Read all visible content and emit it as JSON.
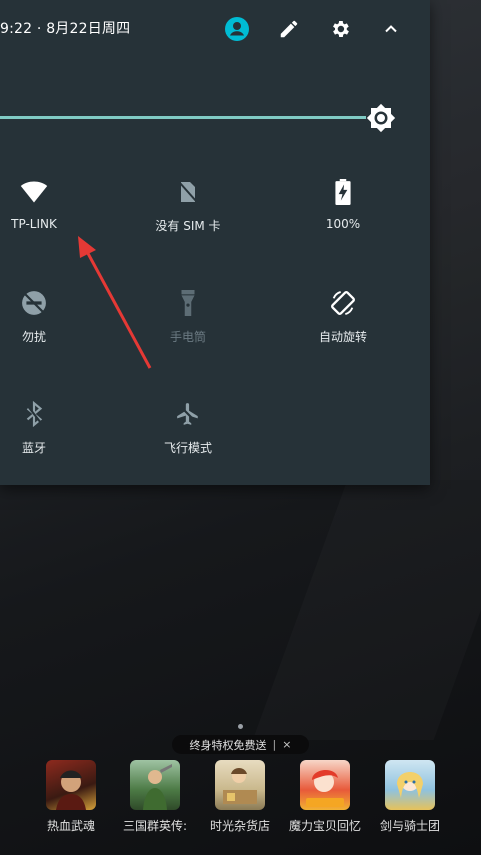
{
  "status_bar": {
    "time_date": "9:22 · 8月22日周四"
  },
  "quick_settings": {
    "tiles": [
      {
        "label": "TP-LINK",
        "icon": "wifi-icon"
      },
      {
        "label": "没有 SIM 卡",
        "icon": "no-sim-icon"
      },
      {
        "label": "100%",
        "icon": "battery-charging-icon"
      },
      {
        "label": "勿扰",
        "icon": "do-not-disturb-icon"
      },
      {
        "label": "手电筒",
        "icon": "flashlight-icon"
      },
      {
        "label": "自动旋转",
        "icon": "auto-rotate-icon"
      },
      {
        "label": "蓝牙",
        "icon": "bluetooth-icon"
      },
      {
        "label": "飞行模式",
        "icon": "airplane-icon"
      }
    ]
  },
  "colors": {
    "shade_bg": "#263238",
    "accent": "#80cbc4",
    "avatar": "#00bcd4",
    "annotation": "#e53935"
  },
  "launcher": {
    "promo": {
      "text": "终身特权免费送",
      "separator": "|",
      "close": "×"
    },
    "apps": [
      {
        "label": "热血武魂"
      },
      {
        "label": "三国群英传:"
      },
      {
        "label": "时光杂货店"
      },
      {
        "label": "魔力宝贝回忆"
      },
      {
        "label": "剑与骑士团"
      }
    ]
  }
}
